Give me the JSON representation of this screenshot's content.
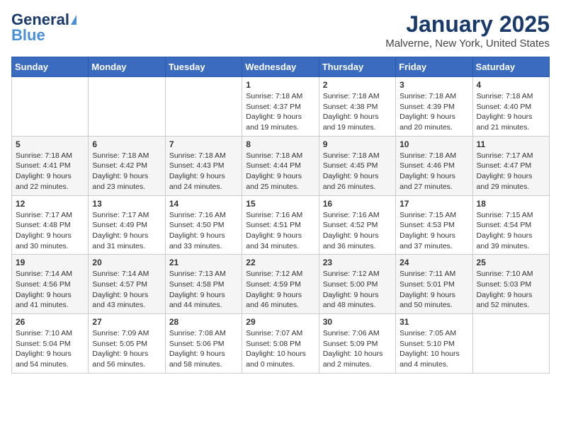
{
  "header": {
    "logo_line1": "General",
    "logo_line2": "Blue",
    "month": "January 2025",
    "location": "Malverne, New York, United States"
  },
  "weekdays": [
    "Sunday",
    "Monday",
    "Tuesday",
    "Wednesday",
    "Thursday",
    "Friday",
    "Saturday"
  ],
  "weeks": [
    [
      {
        "day": "",
        "info": ""
      },
      {
        "day": "",
        "info": ""
      },
      {
        "day": "",
        "info": ""
      },
      {
        "day": "1",
        "info": "Sunrise: 7:18 AM\nSunset: 4:37 PM\nDaylight: 9 hours\nand 19 minutes."
      },
      {
        "day": "2",
        "info": "Sunrise: 7:18 AM\nSunset: 4:38 PM\nDaylight: 9 hours\nand 19 minutes."
      },
      {
        "day": "3",
        "info": "Sunrise: 7:18 AM\nSunset: 4:39 PM\nDaylight: 9 hours\nand 20 minutes."
      },
      {
        "day": "4",
        "info": "Sunrise: 7:18 AM\nSunset: 4:40 PM\nDaylight: 9 hours\nand 21 minutes."
      }
    ],
    [
      {
        "day": "5",
        "info": "Sunrise: 7:18 AM\nSunset: 4:41 PM\nDaylight: 9 hours\nand 22 minutes."
      },
      {
        "day": "6",
        "info": "Sunrise: 7:18 AM\nSunset: 4:42 PM\nDaylight: 9 hours\nand 23 minutes."
      },
      {
        "day": "7",
        "info": "Sunrise: 7:18 AM\nSunset: 4:43 PM\nDaylight: 9 hours\nand 24 minutes."
      },
      {
        "day": "8",
        "info": "Sunrise: 7:18 AM\nSunset: 4:44 PM\nDaylight: 9 hours\nand 25 minutes."
      },
      {
        "day": "9",
        "info": "Sunrise: 7:18 AM\nSunset: 4:45 PM\nDaylight: 9 hours\nand 26 minutes."
      },
      {
        "day": "10",
        "info": "Sunrise: 7:18 AM\nSunset: 4:46 PM\nDaylight: 9 hours\nand 27 minutes."
      },
      {
        "day": "11",
        "info": "Sunrise: 7:17 AM\nSunset: 4:47 PM\nDaylight: 9 hours\nand 29 minutes."
      }
    ],
    [
      {
        "day": "12",
        "info": "Sunrise: 7:17 AM\nSunset: 4:48 PM\nDaylight: 9 hours\nand 30 minutes."
      },
      {
        "day": "13",
        "info": "Sunrise: 7:17 AM\nSunset: 4:49 PM\nDaylight: 9 hours\nand 31 minutes."
      },
      {
        "day": "14",
        "info": "Sunrise: 7:16 AM\nSunset: 4:50 PM\nDaylight: 9 hours\nand 33 minutes."
      },
      {
        "day": "15",
        "info": "Sunrise: 7:16 AM\nSunset: 4:51 PM\nDaylight: 9 hours\nand 34 minutes."
      },
      {
        "day": "16",
        "info": "Sunrise: 7:16 AM\nSunset: 4:52 PM\nDaylight: 9 hours\nand 36 minutes."
      },
      {
        "day": "17",
        "info": "Sunrise: 7:15 AM\nSunset: 4:53 PM\nDaylight: 9 hours\nand 37 minutes."
      },
      {
        "day": "18",
        "info": "Sunrise: 7:15 AM\nSunset: 4:54 PM\nDaylight: 9 hours\nand 39 minutes."
      }
    ],
    [
      {
        "day": "19",
        "info": "Sunrise: 7:14 AM\nSunset: 4:56 PM\nDaylight: 9 hours\nand 41 minutes."
      },
      {
        "day": "20",
        "info": "Sunrise: 7:14 AM\nSunset: 4:57 PM\nDaylight: 9 hours\nand 43 minutes."
      },
      {
        "day": "21",
        "info": "Sunrise: 7:13 AM\nSunset: 4:58 PM\nDaylight: 9 hours\nand 44 minutes."
      },
      {
        "day": "22",
        "info": "Sunrise: 7:12 AM\nSunset: 4:59 PM\nDaylight: 9 hours\nand 46 minutes."
      },
      {
        "day": "23",
        "info": "Sunrise: 7:12 AM\nSunset: 5:00 PM\nDaylight: 9 hours\nand 48 minutes."
      },
      {
        "day": "24",
        "info": "Sunrise: 7:11 AM\nSunset: 5:01 PM\nDaylight: 9 hours\nand 50 minutes."
      },
      {
        "day": "25",
        "info": "Sunrise: 7:10 AM\nSunset: 5:03 PM\nDaylight: 9 hours\nand 52 minutes."
      }
    ],
    [
      {
        "day": "26",
        "info": "Sunrise: 7:10 AM\nSunset: 5:04 PM\nDaylight: 9 hours\nand 54 minutes."
      },
      {
        "day": "27",
        "info": "Sunrise: 7:09 AM\nSunset: 5:05 PM\nDaylight: 9 hours\nand 56 minutes."
      },
      {
        "day": "28",
        "info": "Sunrise: 7:08 AM\nSunset: 5:06 PM\nDaylight: 9 hours\nand 58 minutes."
      },
      {
        "day": "29",
        "info": "Sunrise: 7:07 AM\nSunset: 5:08 PM\nDaylight: 10 hours\nand 0 minutes."
      },
      {
        "day": "30",
        "info": "Sunrise: 7:06 AM\nSunset: 5:09 PM\nDaylight: 10 hours\nand 2 minutes."
      },
      {
        "day": "31",
        "info": "Sunrise: 7:05 AM\nSunset: 5:10 PM\nDaylight: 10 hours\nand 4 minutes."
      },
      {
        "day": "",
        "info": ""
      }
    ]
  ]
}
